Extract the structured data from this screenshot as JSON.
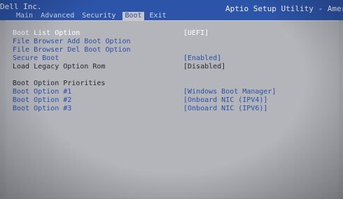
{
  "header": {
    "vendor": "Dell Inc.",
    "utility_title": "Aptio Setup Utility - Amer",
    "colors": {
      "bar": "#2c54a8",
      "active_tab_bg": "#c4c6cc"
    }
  },
  "tabs": [
    {
      "label": "Main",
      "active": false
    },
    {
      "label": "Advanced",
      "active": false
    },
    {
      "label": "Security",
      "active": false
    },
    {
      "label": "Boot",
      "active": true
    },
    {
      "label": "Exit",
      "active": false
    }
  ],
  "boot_menu": {
    "boot_list_option": {
      "label": "Boot List Option",
      "value": "[UEFI]"
    },
    "file_browser_add": {
      "label": "File Browser Add Boot Option"
    },
    "file_browser_del": {
      "label": "File Browser Del Boot Option"
    },
    "secure_boot": {
      "label": "Secure Boot",
      "value": "[Enabled]"
    },
    "load_legacy": {
      "label": "Load Legacy Option Rom",
      "value": "[Disabled]"
    },
    "priorities_heading": "Boot Option Priorities",
    "boot_options": [
      {
        "label": "Boot Option #1",
        "value": "[Windows Boot Manager]"
      },
      {
        "label": "Boot Option #2",
        "value": "[Onboard NIC (IPV4)]"
      },
      {
        "label": "Boot Option #3",
        "value": "[Onboard NIC (IPV6)]"
      }
    ]
  }
}
